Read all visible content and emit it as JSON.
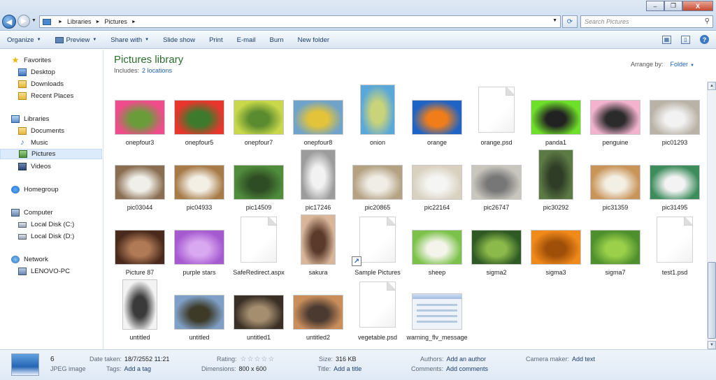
{
  "window": {
    "minimize": "–",
    "maximize": "❐",
    "close": "X"
  },
  "address": {
    "crumbs": [
      "Libraries",
      "Pictures"
    ],
    "separator": "►"
  },
  "search": {
    "placeholder": "Search Pictures"
  },
  "toolbar": {
    "items": [
      "Organize",
      "Preview",
      "Share with",
      "Slide show",
      "Print",
      "E-mail",
      "Burn",
      "New folder"
    ]
  },
  "nav": {
    "favorites": "Favorites",
    "desktop": "Desktop",
    "downloads": "Downloads",
    "recent": "Recent Places",
    "libraries": "Libraries",
    "documents": "Documents",
    "music": "Music",
    "pictures": "Pictures",
    "videos": "Videos",
    "homegroup": "Homegroup",
    "computer": "Computer",
    "disk_c": "Local Disk (C:)",
    "disk_d": "Local Disk (D:)",
    "network": "Network",
    "lenovo": "LENOVO-PC"
  },
  "header": {
    "title": "Pictures library",
    "includes_label": "Includes:",
    "includes_link": "2 locations",
    "arrange_label": "Arrange by:",
    "arrange_value": "Folder"
  },
  "files": [
    {
      "name": "onepfour3",
      "kind": "land",
      "colors": [
        "#f04b8a",
        "#6a9c3a"
      ]
    },
    {
      "name": "onepfour5",
      "kind": "land",
      "colors": [
        "#e8362d",
        "#3d7a2b"
      ]
    },
    {
      "name": "onepfour7",
      "kind": "land",
      "colors": [
        "#c8d84a",
        "#5a8b2e"
      ]
    },
    {
      "name": "onepfour8",
      "kind": "land",
      "colors": [
        "#6fa3c9",
        "#e3c33a"
      ]
    },
    {
      "name": "onion",
      "kind": "port",
      "colors": [
        "#5aa8d8",
        "#c9d37a"
      ]
    },
    {
      "name": "orange",
      "kind": "land",
      "colors": [
        "#1f63c4",
        "#f07d1a"
      ]
    },
    {
      "name": "orange.psd",
      "kind": "doc",
      "colors": []
    },
    {
      "name": "panda1",
      "kind": "land",
      "colors": [
        "#6ee02a",
        "#222222"
      ]
    },
    {
      "name": "penguine",
      "kind": "land",
      "colors": [
        "#f3b3cf",
        "#2b2b2b"
      ]
    },
    {
      "name": "pic01293",
      "kind": "land",
      "colors": [
        "#b9b2a6",
        "#f2f2f2"
      ]
    },
    {
      "name": "pic03044",
      "kind": "land",
      "colors": [
        "#8a6e52",
        "#f1efe9"
      ]
    },
    {
      "name": "pic04933",
      "kind": "land",
      "colors": [
        "#a77b48",
        "#f3efe5"
      ]
    },
    {
      "name": "pic14509",
      "kind": "land",
      "colors": [
        "#4f8c3b",
        "#2f4d24"
      ]
    },
    {
      "name": "pic17246",
      "kind": "port",
      "colors": [
        "#9c9c9c",
        "#f2f2f2"
      ]
    },
    {
      "name": "pic20865",
      "kind": "land",
      "colors": [
        "#b4a283",
        "#f0ede6"
      ]
    },
    {
      "name": "pic22164",
      "kind": "land",
      "colors": [
        "#d9d1c0",
        "#f5f5f3"
      ]
    },
    {
      "name": "pic26747",
      "kind": "land",
      "colors": [
        "#c9c6be",
        "#777777"
      ]
    },
    {
      "name": "pic30292",
      "kind": "port",
      "colors": [
        "#5c7a44",
        "#2f3d26"
      ]
    },
    {
      "name": "pic31359",
      "kind": "land",
      "colors": [
        "#c99458",
        "#f3efe5"
      ]
    },
    {
      "name": "pic31495",
      "kind": "land",
      "colors": [
        "#3d8c5c",
        "#f3f3f3"
      ]
    },
    {
      "name": "Picture 87",
      "kind": "land",
      "colors": [
        "#4a2a1c",
        "#b07a56"
      ]
    },
    {
      "name": "purple stars",
      "kind": "land",
      "colors": [
        "#a65ad0",
        "#d8a8f0"
      ]
    },
    {
      "name": "SafeRedirect.aspx",
      "kind": "doc",
      "colors": []
    },
    {
      "name": "sakura",
      "kind": "port",
      "colors": [
        "#d9b59a",
        "#5a3a2a"
      ]
    },
    {
      "name": "Sample Pictures",
      "kind": "doc",
      "colors": [],
      "shortcut": true
    },
    {
      "name": "sheep",
      "kind": "land",
      "colors": [
        "#7cc24a",
        "#f4f4ea"
      ]
    },
    {
      "name": "sigma2",
      "kind": "land",
      "colors": [
        "#2f5a24",
        "#8cba4a"
      ]
    },
    {
      "name": "sigma3",
      "kind": "land",
      "colors": [
        "#f08a1a",
        "#a04f08"
      ]
    },
    {
      "name": "sigma7",
      "kind": "land",
      "colors": [
        "#4e8f2e",
        "#9bd04a"
      ]
    },
    {
      "name": "test1.psd",
      "kind": "doc",
      "colors": []
    },
    {
      "name": "untitled",
      "kind": "port",
      "colors": [
        "#f3f3f3",
        "#3a3a3a"
      ]
    },
    {
      "name": "untitled",
      "kind": "land",
      "colors": [
        "#7fa0c6",
        "#3d3a28"
      ]
    },
    {
      "name": "untitled1",
      "kind": "land",
      "colors": [
        "#3a2f25",
        "#a58e70"
      ]
    },
    {
      "name": "untitled2",
      "kind": "land",
      "colors": [
        "#c98e5c",
        "#4a3a30"
      ]
    },
    {
      "name": "vegetable.psd",
      "kind": "doc",
      "colors": []
    },
    {
      "name": "warning_flv_message",
      "kind": "shot",
      "colors": []
    }
  ],
  "details": {
    "name": "6",
    "type": "JPEG image",
    "date_taken_label": "Date taken:",
    "date_taken": "18/7/2552 11:21",
    "tags_label": "Tags:",
    "tags": "Add a tag",
    "rating_label": "Rating:",
    "rating_stars": "☆☆☆☆☆",
    "dimensions_label": "Dimensions:",
    "dimensions": "800 x 600",
    "size_label": "Size:",
    "size": "316 KB",
    "title_label": "Title:",
    "title": "Add a title",
    "authors_label": "Authors:",
    "authors": "Add an author",
    "comments_label": "Comments:",
    "comments": "Add comments",
    "camera_label": "Camera maker:",
    "camera": "Add text"
  }
}
